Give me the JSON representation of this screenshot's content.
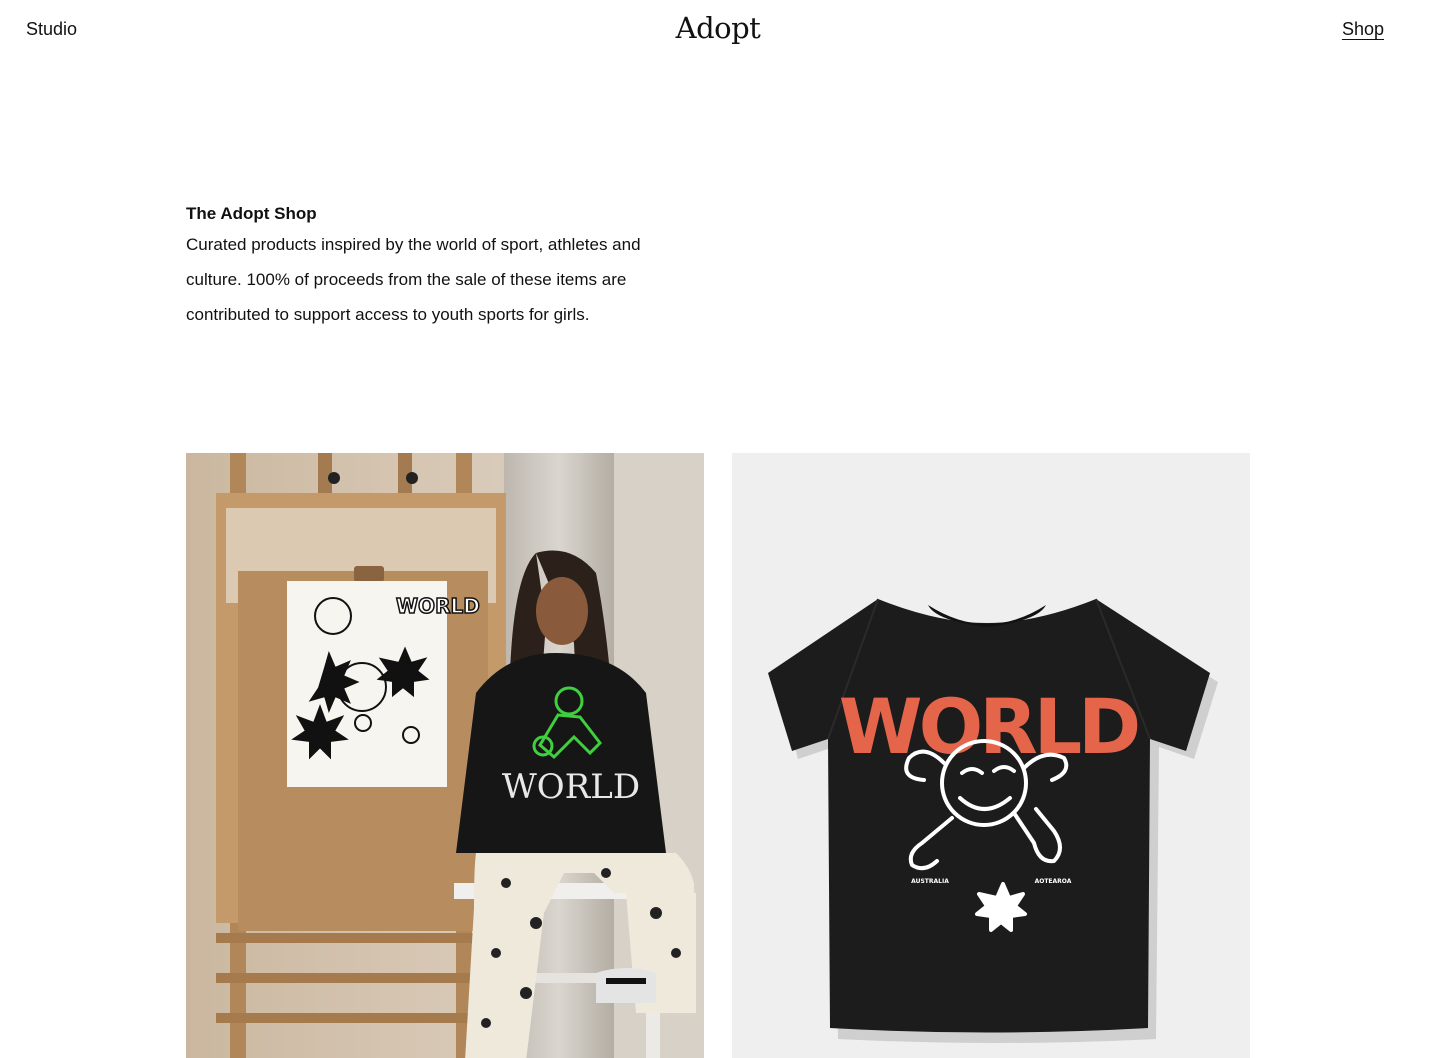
{
  "header": {
    "nav_left": "Studio",
    "logo": "Adopt",
    "nav_right": "Shop"
  },
  "intro": {
    "title": "The Adopt Shop",
    "lines": [
      "Curated products inspired by the world of sport, athletes and",
      "culture. 100% of proceeds from the sale of these items are",
      "contributed to support access to youth sports for girls."
    ]
  },
  "products": [
    {
      "name": "lifestyle-photo",
      "poster_text": "WORLD",
      "shirt_text": "WORLD"
    },
    {
      "name": "tshirt-photo",
      "shirt_text": "WORLD",
      "left_print": "AUSTRALIA",
      "right_print": "AOTEAROA"
    }
  ],
  "colors": {
    "text": "#111111",
    "background": "#ffffff",
    "tshirt_bg": "#efefef",
    "shirt": "#1a1a1a",
    "print_orange": "#e5654a",
    "print_green": "#3fcf3f"
  }
}
